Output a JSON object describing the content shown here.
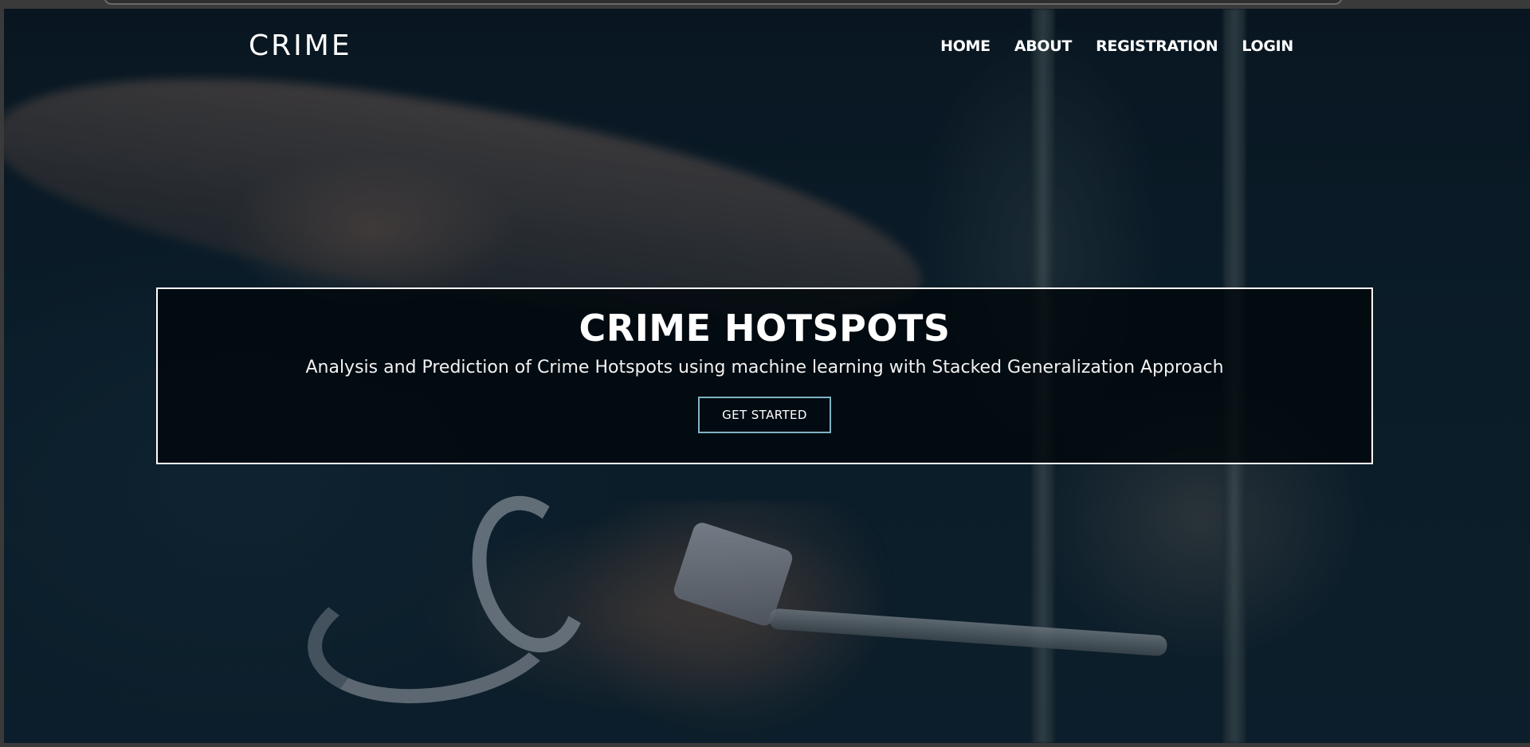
{
  "navbar": {
    "brand": "CRIME",
    "links": [
      {
        "label": "HOME"
      },
      {
        "label": "ABOUT"
      },
      {
        "label": "REGISTRATION"
      },
      {
        "label": "LOGIN"
      }
    ]
  },
  "hero": {
    "title": "CRIME HOTSPOTS",
    "subtitle": "Analysis and Prediction of Crime Hotspots using machine learning with Stacked Generalization Approach",
    "cta_label": "GET STARTED"
  },
  "colors": {
    "overlay": "#000a10",
    "text": "#ffffff",
    "cta_border": "#7fb4c4",
    "background": "#0e2330"
  }
}
